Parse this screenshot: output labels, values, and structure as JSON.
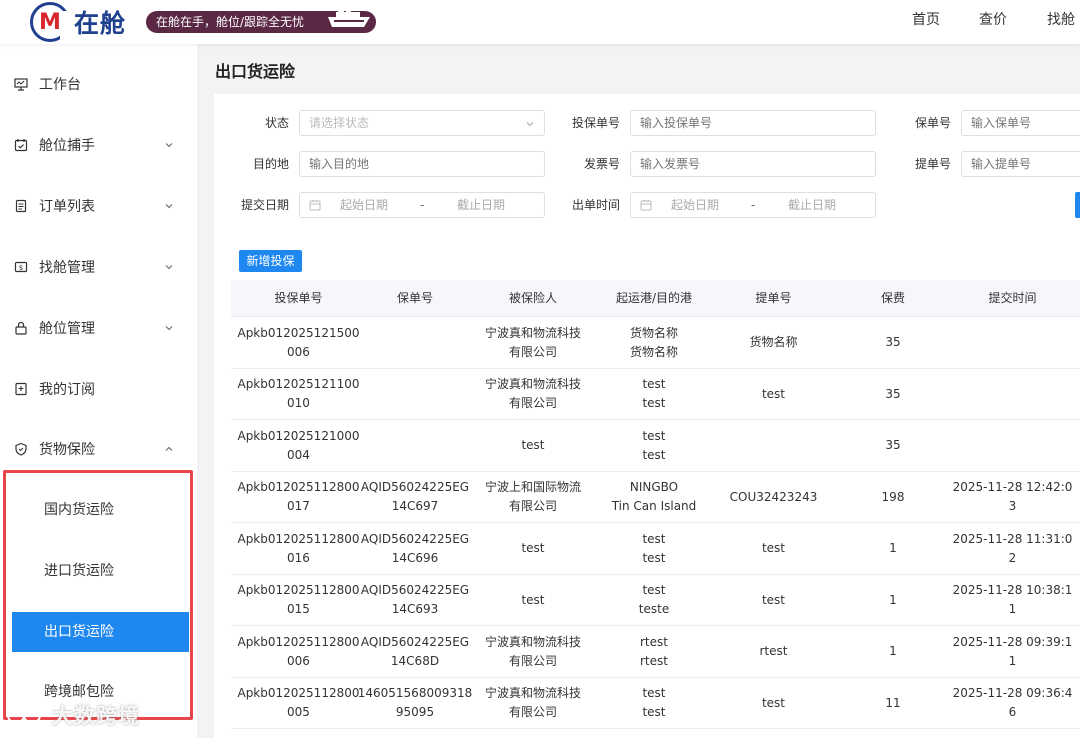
{
  "app": {
    "logo_letter": "M",
    "logo_text": "在舱",
    "slogan": "在舱在手，舱位/跟踪全无忧"
  },
  "top_nav": [
    {
      "label": "首页"
    },
    {
      "label": "查价"
    },
    {
      "label": "找舱"
    }
  ],
  "sidebar": {
    "items": [
      {
        "label": "工作台",
        "icon": "monitor-icon"
      },
      {
        "label": "舱位捕手",
        "icon": "calendar-check-icon"
      },
      {
        "label": "订单列表",
        "icon": "document-icon"
      },
      {
        "label": "找舱管理",
        "icon": "dollar-icon"
      },
      {
        "label": "舱位管理",
        "icon": "lock-icon"
      },
      {
        "label": "我的订阅",
        "icon": "bookmark-icon"
      },
      {
        "label": "货物保险",
        "icon": "shield-icon"
      }
    ],
    "sub_items": [
      {
        "label": "国内货运险"
      },
      {
        "label": "进口货运险"
      },
      {
        "label": "出口货运险",
        "active": true
      },
      {
        "label": "跨境邮包险"
      }
    ]
  },
  "watermark": "大数跨境",
  "page": {
    "title": "出口货运险"
  },
  "filters": {
    "status_label": "状态",
    "status_placeholder": "请选择状态",
    "policy_app_label": "投保单号",
    "policy_app_placeholder": "输入投保单号",
    "policy_no_label": "保单号",
    "policy_no_placeholder": "输入保单号",
    "destination_label": "目的地",
    "destination_placeholder": "输入目的地",
    "invoice_label": "发票号",
    "invoice_placeholder": "输入发票号",
    "bl_label": "提单号",
    "bl_placeholder": "输入提单号",
    "submit_date_label": "提交日期",
    "issue_time_label": "出单时间",
    "start_date": "起始日期",
    "end_date": "截止日期",
    "range_sep": "-"
  },
  "toolbar": {
    "add_label": "新增投保"
  },
  "table": {
    "headers": [
      "投保单号",
      "保单号",
      "被保险人",
      "起运港/目的港",
      "提单号",
      "保费",
      "提交时间"
    ],
    "rows": [
      [
        "Apkb012025121500\n006",
        "",
        "宁波真和物流科技\n有限公司",
        "货物名称\n货物名称",
        "货物名称",
        "35",
        ""
      ],
      [
        "Apkb012025121100\n010",
        "",
        "宁波真和物流科技\n有限公司",
        "test\ntest",
        "test",
        "35",
        ""
      ],
      [
        "Apkb012025121000\n004",
        "",
        "test",
        "test\ntest",
        "",
        "35",
        ""
      ],
      [
        "Apkb012025112800\n017",
        "AQID56024225EG\n14C697",
        "宁波上和国际物流\n有限公司",
        "NINGBO\nTin Can Island",
        "COU32423243",
        "198",
        "2025-11-28 12:42:0\n3"
      ],
      [
        "Apkb012025112800\n016",
        "AQID56024225EG\n14C696",
        "test",
        "test\ntest",
        "test",
        "1",
        "2025-11-28 11:31:0\n2"
      ],
      [
        "Apkb012025112800\n015",
        "AQID56024225EG\n14C693",
        "test",
        "test\nteste",
        "test",
        "1",
        "2025-11-28 10:38:1\n1"
      ],
      [
        "Apkb012025112800\n006",
        "AQID56024225EG\n14C68D",
        "宁波真和物流科技\n有限公司",
        "rtest\nrtest",
        "rtest",
        "1",
        "2025-11-28 09:39:1\n1"
      ],
      [
        "Apkb012025112800\n005",
        "146051568009318\n95095",
        "宁波真和物流科技\n有限公司",
        "test\ntest",
        "test",
        "11",
        "2025-11-28 09:36:4\n6"
      ]
    ]
  }
}
